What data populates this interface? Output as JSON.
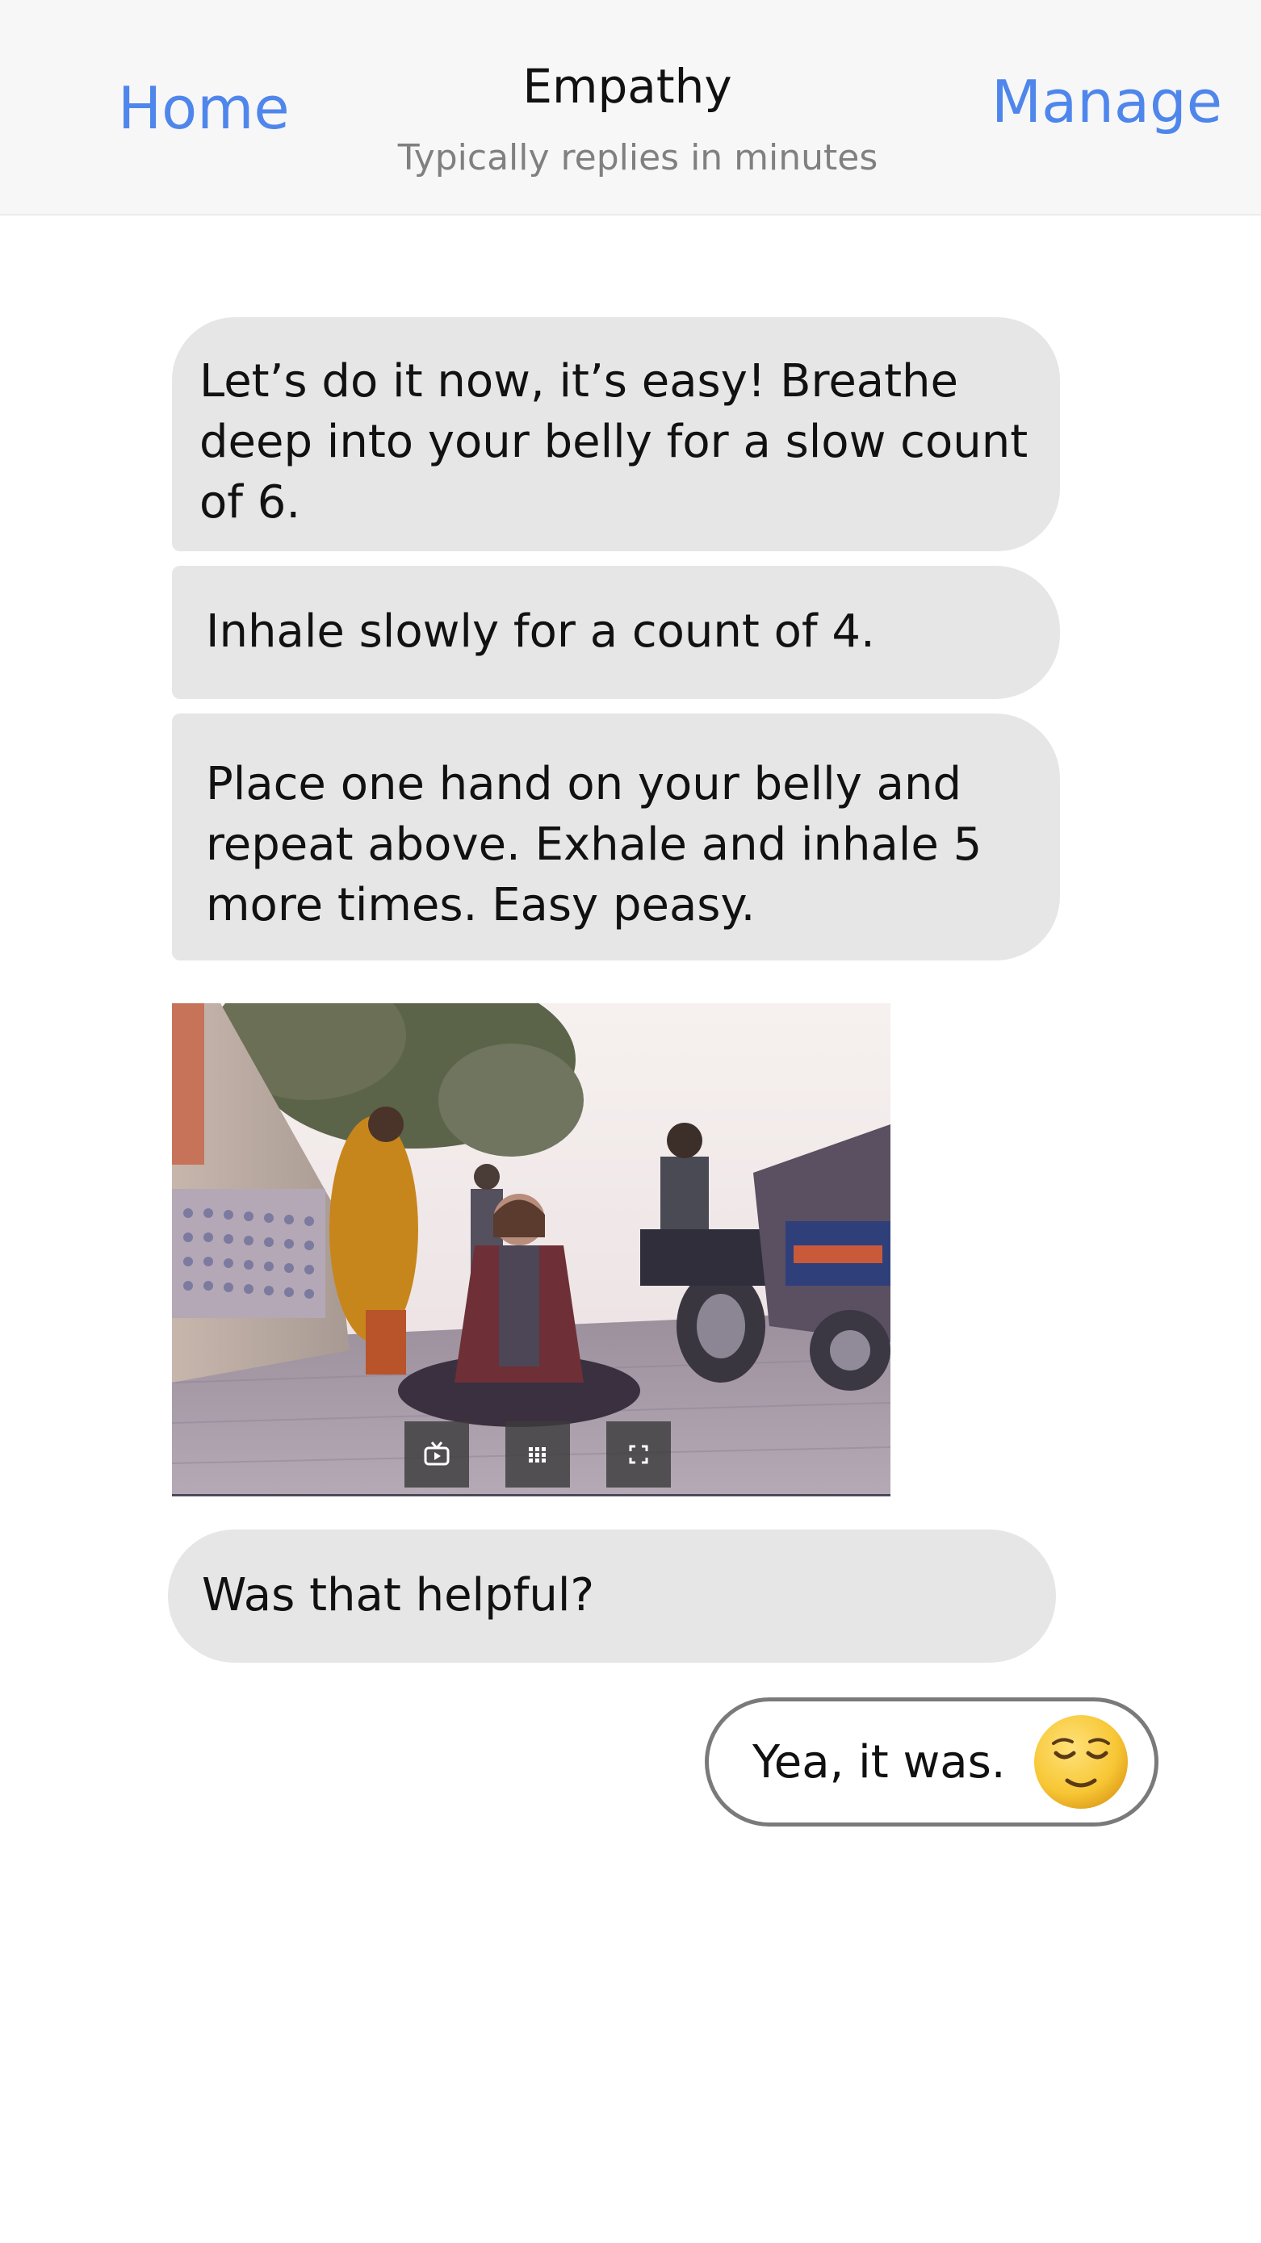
{
  "header": {
    "left_label": "Home",
    "title": "Empathy",
    "subtitle": "Typically replies in minutes",
    "right_label": "Manage",
    "accent_color": "#4f86ec"
  },
  "messages": [
    {
      "from": "bot",
      "text": "Let’s do it now, it’s easy! Breathe deep into your belly for a slow count of 6."
    },
    {
      "from": "bot",
      "text": "Inhale slowly for a count of 4."
    },
    {
      "from": "bot",
      "text": "Place one hand on your belly and repeat above. Exhale and inhale 5 more times. Easy peasy."
    },
    {
      "from": "bot",
      "type": "image",
      "controls": [
        "tv-icon",
        "grid-icon",
        "fullscreen-icon"
      ]
    },
    {
      "from": "bot",
      "text": "Was that helpful?"
    },
    {
      "from": "user",
      "text": "Yea, it was.",
      "emoji": "relieved-face-emoji"
    }
  ],
  "colors": {
    "bot_bubble": "#e7e6e7",
    "user_bubble_border": "#7a7a7a",
    "header_bg": "#f7f7f7"
  }
}
